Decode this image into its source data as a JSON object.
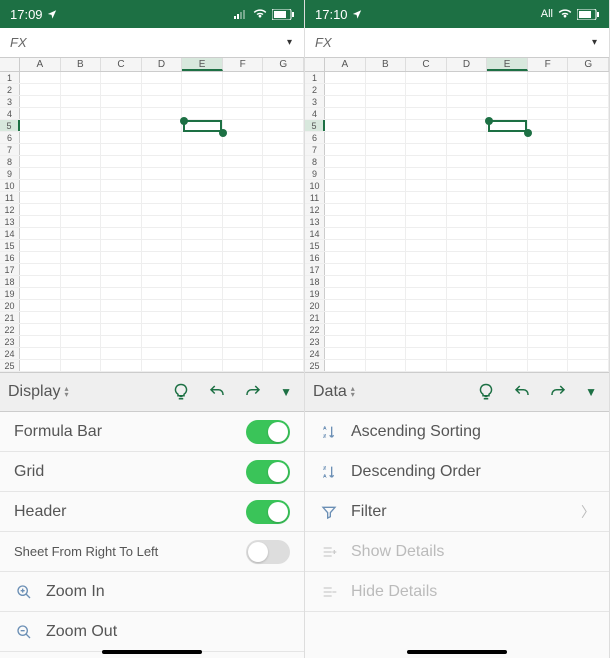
{
  "left": {
    "status": {
      "time": "17:09",
      "network": ""
    },
    "formula": {
      "fx": "FX"
    },
    "columns": [
      "A",
      "B",
      "C",
      "D",
      "E",
      "F",
      "G"
    ],
    "rows": [
      1,
      2,
      3,
      4,
      5,
      6,
      7,
      8,
      9,
      10,
      11,
      12,
      13,
      14,
      15,
      16,
      17,
      18,
      19,
      20,
      21,
      22,
      23,
      24,
      25
    ],
    "selected": {
      "col": "E",
      "row": 5
    },
    "toolbar": {
      "tab": "Display"
    },
    "menu": {
      "formula_bar": "Formula Bar",
      "grid": "Grid",
      "header": "Header",
      "sheet_rtl": "Sheet From Right To Left",
      "zoom_in": "Zoom In",
      "zoom_out": "Zoom Out"
    },
    "toggles": {
      "formula_bar": true,
      "grid": true,
      "header": true,
      "sheet_rtl": false
    }
  },
  "right": {
    "status": {
      "time": "17:10",
      "network": "All"
    },
    "formula": {
      "fx": "FX"
    },
    "columns": [
      "A",
      "B",
      "C",
      "D",
      "E",
      "F",
      "G"
    ],
    "rows": [
      1,
      2,
      3,
      4,
      5,
      6,
      7,
      8,
      9,
      10,
      11,
      12,
      13,
      14,
      15,
      16,
      17,
      18,
      19,
      20,
      21,
      22,
      23,
      24,
      25
    ],
    "selected": {
      "col": "E",
      "row": 5
    },
    "toolbar": {
      "tab": "Data"
    },
    "menu": {
      "asc": "Ascending Sorting",
      "desc": "Descending Order",
      "filter": "Filter",
      "show_details": "Show Details",
      "hide_details": "Hide Details"
    }
  }
}
